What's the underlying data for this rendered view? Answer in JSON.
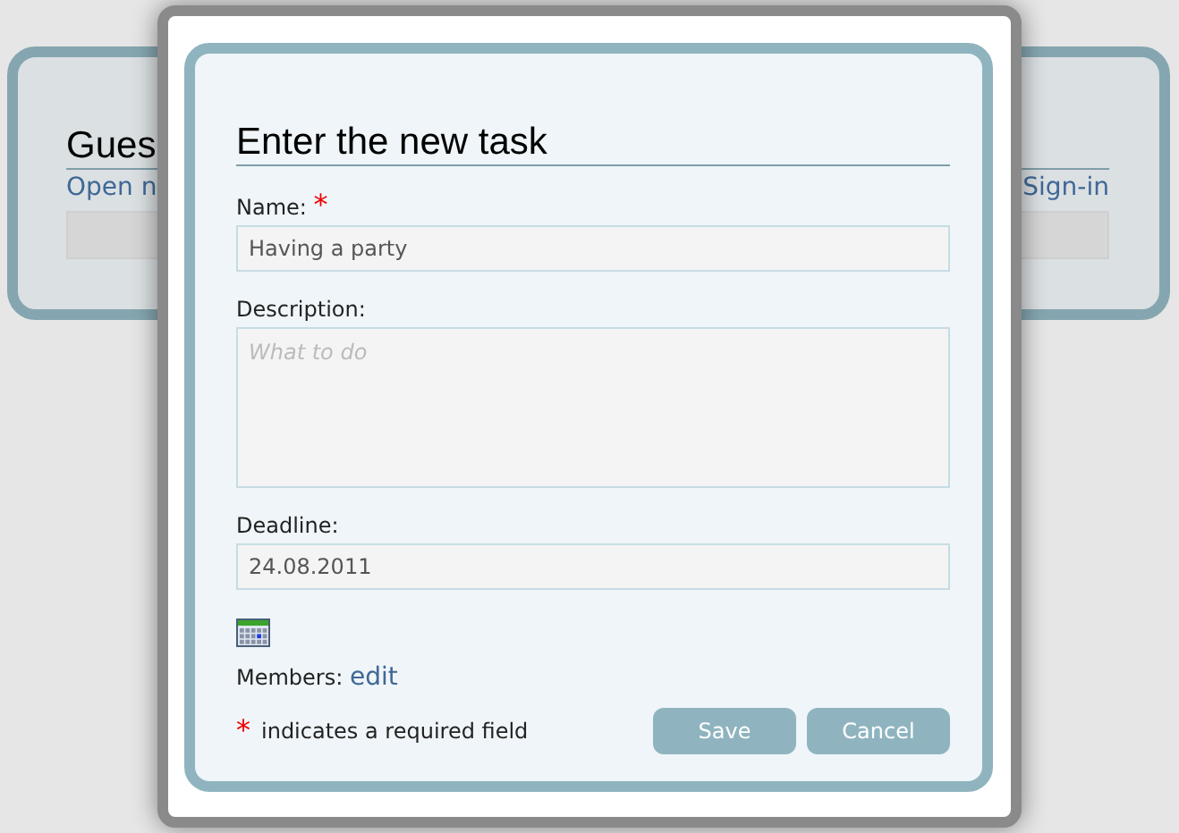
{
  "background_page": {
    "heading": "Gues",
    "link_left": "Open n",
    "link_right": "Sign-in"
  },
  "dialog": {
    "title": "Enter the new task",
    "fields": [
      {
        "kind": "text",
        "label": "Name:",
        "required_mark": "*",
        "value": "Having a party"
      },
      {
        "kind": "textarea",
        "label": "Description:",
        "placeholder": "What to do"
      },
      {
        "kind": "text",
        "label": "Deadline:",
        "value": "24.08.2011"
      }
    ],
    "members": {
      "label": "Members:",
      "link": "edit"
    },
    "required_note": {
      "mark": "*",
      "text": "indicates a required field"
    },
    "buttons": [
      "Save",
      "Cancel"
    ]
  }
}
